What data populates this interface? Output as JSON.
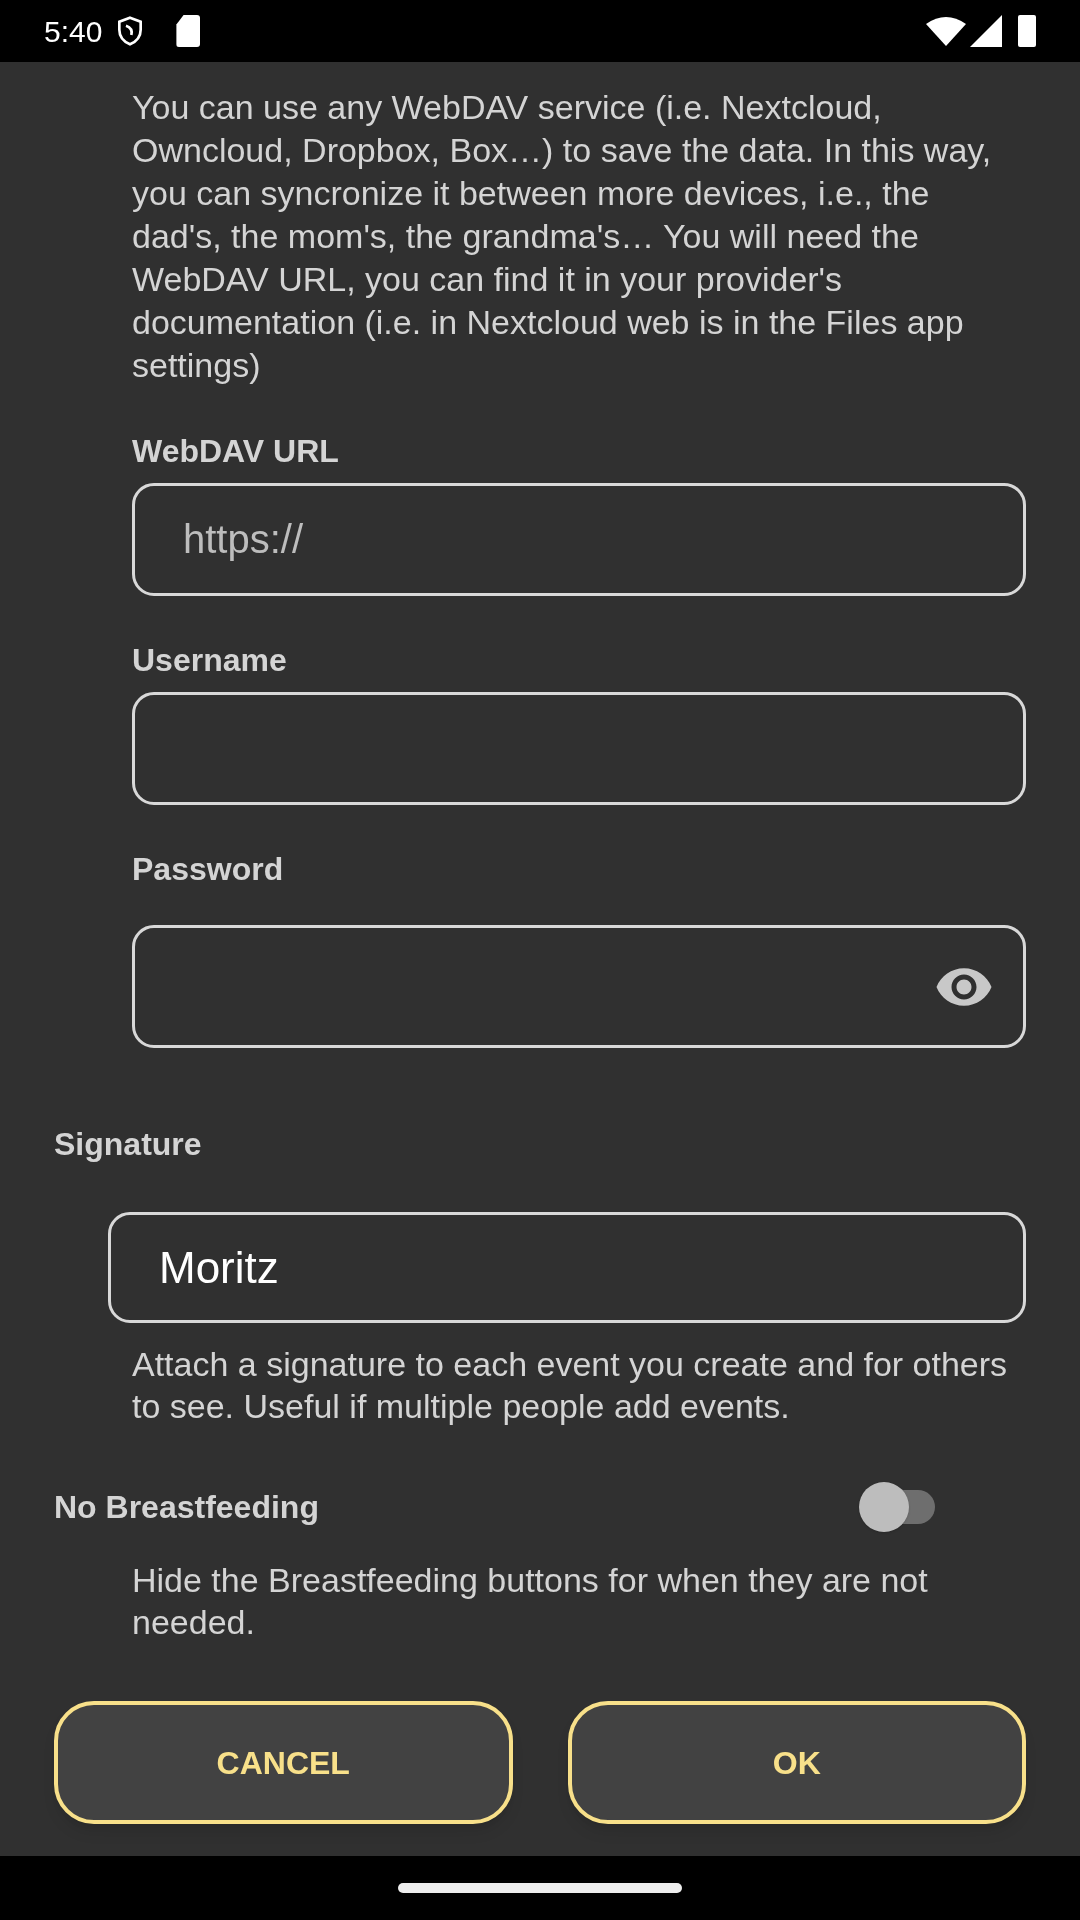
{
  "status_bar": {
    "time": "5:40"
  },
  "webdav": {
    "description": "You can use any WebDAV service (i.e. Nextcloud, Owncloud, Dropbox, Box…) to save the data. In this way, you can syncronize it between more devices, i.e., the dad's, the mom's, the grandma's… You will need the WebDAV URL, you can find it in your provider's documentation (i.e. in Nextcloud web is in the Files app settings)",
    "fields": [
      {
        "kind": "text",
        "label": "WebDAV URL",
        "placeholder": "https://"
      },
      {
        "kind": "text",
        "label": "Username"
      },
      {
        "kind": "password",
        "label": "Password"
      }
    ]
  },
  "signature": {
    "label": "Signature",
    "value": "Moritz",
    "help": "Attach a signature to each event you create and for others to see. Useful if multiple people add events."
  },
  "no_breastfeeding": {
    "label": "No Breastfeeding",
    "on": false,
    "help": "Hide the Breastfeeding buttons for when they are not needed."
  },
  "buttons": [
    "CANCEL",
    "OK"
  ]
}
